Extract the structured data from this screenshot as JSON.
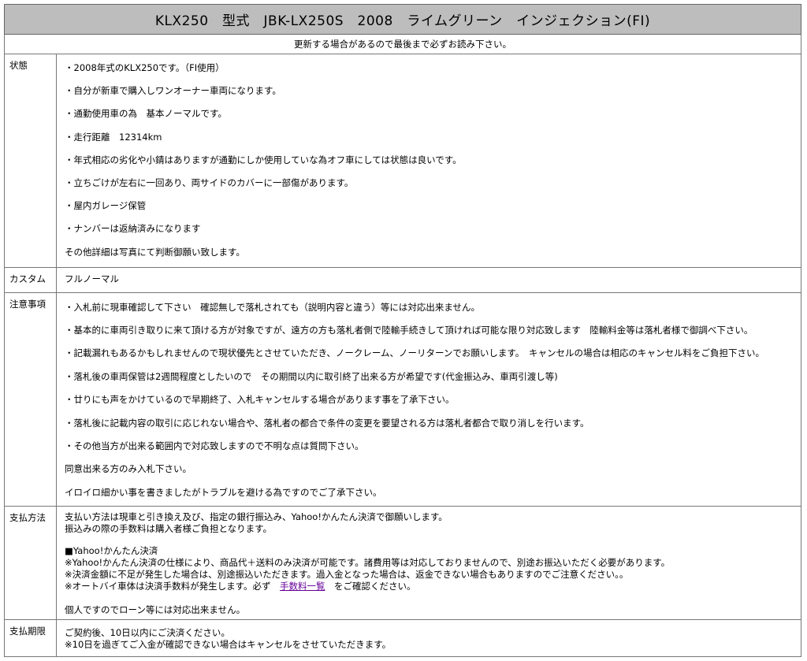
{
  "title": "KLX250　型式　JBK-LX250S　2008　ライムグリーン　インジェクション(FI)",
  "subtitle": "更新する場合があるので最後まで必ずお読み下さい。",
  "condition": {
    "label": "状態",
    "items": [
      "・2008年式のKLX250です。（FI使用）",
      "・自分が新車で購入しワンオーナー車両になります。",
      "・通勤使用車の為　基本ノーマルです。",
      "・走行距離　12314km",
      "・年式相応の劣化や小錆はありますが通勤にしか使用していな為オフ車にしては状態は良いです。",
      "・立ちごけが左右に一回あり、両サイドのカバーに一部傷があります。",
      "・屋内ガレージ保管",
      "・ナンバーは返納済みになります",
      "その他詳細は写真にて判断御願い致します。"
    ]
  },
  "custom": {
    "label": "カスタム",
    "value": "フルノーマル"
  },
  "notes": {
    "label": "注意事項",
    "items": [
      "・入札前に現車確認して下さい　確認無しで落札されても（説明内容と違う）等には対応出来ません。",
      "・基本的に車両引き取りに来て頂ける方が対象ですが、遠方の方も落札者側で陸輸手続きして頂ければ可能な限り対応致します　陸輸料金等は落札者様で御調べ下さい。",
      "・記載漏れもあるかもしれませんので現状優先とさせていただき、ノークレーム、ノーリターンでお願いします。　キャンセルの場合は相応のキャンセル料をご負担下さい。",
      "・落札後の車両保管は2週間程度としたいので　その期間以内に取引終了出来る方が希望です(代金振込み、車両引渡し等)",
      "・廿りにも声をかけているので早期終了、入札キャンセルする場合があります事を了承下さい。",
      "・落札後に記載内容の取引に応じれない場合や、落札者の都合で条件の変更を要望される方は落札者都合で取り消しを行います。",
      "・その他当方が出来る範囲内で対応致しますので不明な点は質問下さい。",
      "同意出来る方のみ入札下さい。",
      "イロイロ細かい事を書きましたがトラブルを避ける為ですのでご了承下さい。"
    ]
  },
  "payment": {
    "label": "支払方法",
    "line1": "支払い方法は現車と引き換え及び、指定の銀行振込み、Yahoo!かんたん決済で御願いします。",
    "line2": "振込みの際の手数料は購入者様ご負担となります。",
    "yahoo_heading": "■Yahoo!かんたん決済",
    "note1": "※Yahoo!かんたん決済の仕様により、商品代＋送料のみ決済が可能です。諸費用等は対応しておりませんので、別途お振込いただく必要があります。",
    "note2": "※決済金額に不足が発生した場合は、別途振込いただきます。過入金となった場合は、返金できない場合もありますのでご注意ください。。",
    "note3_before": "※オートバイ車体は決済手数料が発生します。必ず　",
    "note3_link": "手数料一覧",
    "note3_after": "　をご確認ください。",
    "loan": "個人ですのでローン等には対応出来ません。"
  },
  "deadline": {
    "label": "支払期限",
    "line1": "ご契約後、10日以内にご決済ください。",
    "line2": "※10日を過ぎてご入金が確認できない場合はキャンセルをさせていただきます。"
  },
  "colors": {
    "title_bg": "#bdbdbd",
    "border": "#777777",
    "link": "#660099"
  }
}
